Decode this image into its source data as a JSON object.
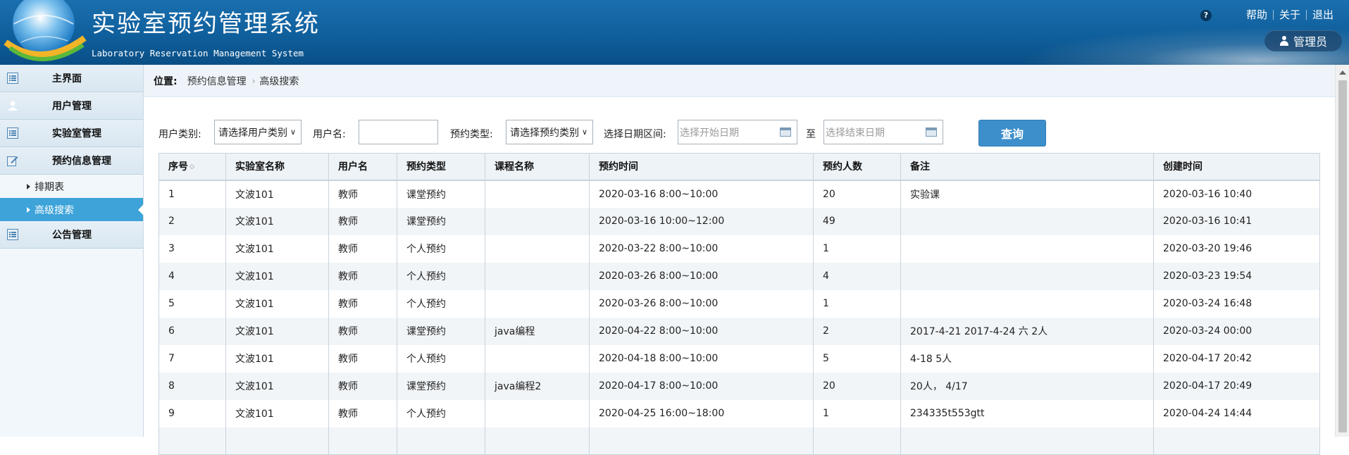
{
  "header": {
    "title": "实验室预约管理系统",
    "subtitle": "Laboratory Reservation Management System",
    "help_icon": "?",
    "links": [
      "帮助",
      "关于",
      "退出"
    ],
    "user_label": "管理员"
  },
  "sidebar": {
    "items": [
      {
        "label": "主界面",
        "icon": "list-icon"
      },
      {
        "label": "用户管理",
        "icon": "user-icon"
      },
      {
        "label": "实验室管理",
        "icon": "list-icon"
      },
      {
        "label": "预约信息管理",
        "icon": "edit-icon"
      }
    ],
    "sub_items": [
      {
        "label": "排期表",
        "active": false
      },
      {
        "label": "高级搜索",
        "active": true
      }
    ],
    "bottom_item": {
      "label": "公告管理",
      "icon": "list-icon"
    }
  },
  "breadcrumb": {
    "label": "位置:",
    "items": [
      "预约信息管理",
      "高级搜索"
    ]
  },
  "filters": {
    "user_type_label": "用户类别:",
    "user_type_value": "请选择用户类别",
    "username_label": "用户名:",
    "username_value": "",
    "reserve_type_label": "预约类型:",
    "reserve_type_value": "请选择预约类别",
    "date_label": "选择日期区间:",
    "start_placeholder": "选择开始日期",
    "to_label": "至",
    "end_placeholder": "选择结束日期",
    "query_button": "查询"
  },
  "table": {
    "columns": [
      "序号",
      "实验室名称",
      "用户名",
      "预约类型",
      "课程名称",
      "预约时间",
      "预约人数",
      "备注",
      "创建时间"
    ],
    "rows": [
      [
        "1",
        "文波101",
        "教师",
        "课堂预约",
        "",
        "2020-03-16 8:00~10:00",
        "20",
        "实验课",
        "2020-03-16 10:40"
      ],
      [
        "2",
        "文波101",
        "教师",
        "课堂预约",
        "",
        "2020-03-16 10:00~12:00",
        "49",
        "",
        "2020-03-16 10:41"
      ],
      [
        "3",
        "文波101",
        "教师",
        "个人预约",
        "",
        "2020-03-22 8:00~10:00",
        "1",
        "",
        "2020-03-20 19:46"
      ],
      [
        "4",
        "文波101",
        "教师",
        "个人预约",
        "",
        "2020-03-26 8:00~10:00",
        "4",
        "",
        "2020-03-23 19:54"
      ],
      [
        "5",
        "文波101",
        "教师",
        "个人预约",
        "",
        "2020-03-26 8:00~10:00",
        "1",
        "",
        "2020-03-24 16:48"
      ],
      [
        "6",
        "文波101",
        "教师",
        "课堂预约",
        "java编程",
        "2020-04-22 8:00~10:00",
        "2",
        "2017-4-21 2017-4-24 六 2人",
        "2020-03-24 00:00"
      ],
      [
        "7",
        "文波101",
        "教师",
        "个人预约",
        "",
        "2020-04-18 8:00~10:00",
        "5",
        "4-18 5人",
        "2020-04-17 20:42"
      ],
      [
        "8",
        "文波101",
        "教师",
        "课堂预约",
        "java编程2",
        "2020-04-17 8:00~10:00",
        "20",
        "20人， 4/17",
        "2020-04-17 20:49"
      ],
      [
        "9",
        "文波101",
        "教师",
        "个人预约",
        "",
        "2020-04-25 16:00~18:00",
        "1",
        "234335t553gtt",
        "2020-04-24 14:44"
      ],
      [
        "",
        "",
        "",
        "",
        "",
        "",
        "",
        "",
        ""
      ]
    ]
  },
  "colors": {
    "header_bg": "#0f5f9c",
    "active_menu": "#3da3d9",
    "query_button": "#3d8fcb"
  }
}
